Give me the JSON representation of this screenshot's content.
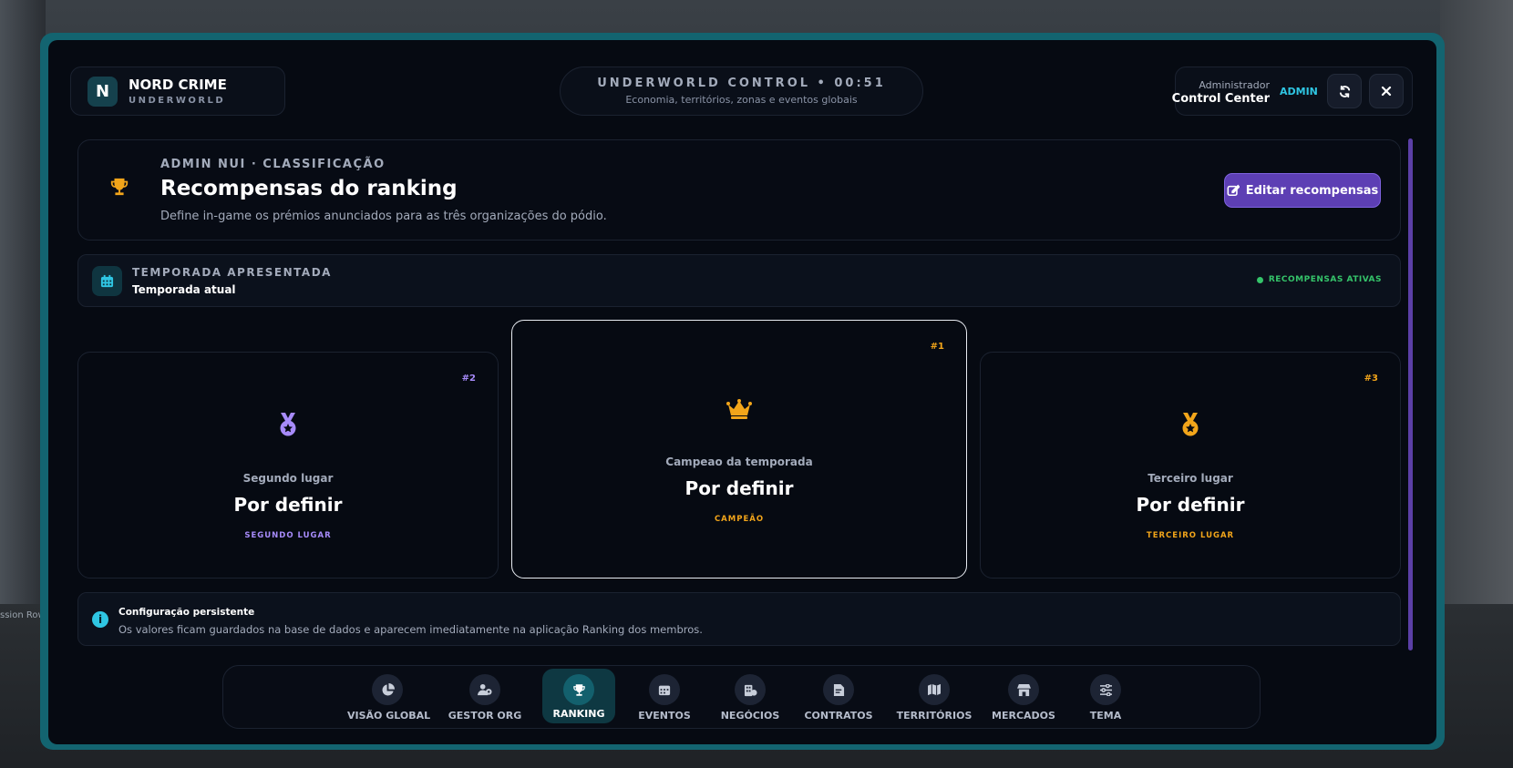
{
  "background": {
    "left_text": "ssion Row"
  },
  "brand": {
    "initial": "N",
    "title": "NORD CRIME",
    "subtitle": "UNDERWORLD"
  },
  "header": {
    "title": "UNDERWORLD CONTROL • 00:51",
    "subtitle": "Economia, territórios, zonas e eventos globais"
  },
  "admin": {
    "role": "Administrador",
    "name": "Control Center",
    "tag": "ADMIN"
  },
  "hero": {
    "kicker": "ADMIN NUI · CLASSIFICAÇÃO",
    "title": "Recompensas do ranking",
    "description": "Define in-game os prémios anunciados para as três organizações do pódio.",
    "edit_label": "Editar recompensas"
  },
  "season": {
    "kicker": "TEMPORADA APRESENTADA",
    "name": "Temporada atual",
    "status": "RECOMPENSAS ATIVAS"
  },
  "podium": {
    "second": {
      "rank": "#2",
      "subtitle": "Segundo lugar",
      "title": "Por definir",
      "tag": "SEGUNDO LUGAR",
      "color": "#a78bfa",
      "icon": "medal-icon"
    },
    "first": {
      "rank": "#1",
      "subtitle": "Campeao da temporada",
      "title": "Por definir",
      "tag": "CAMPEÃO",
      "color": "#f2a51a",
      "icon": "crown-icon"
    },
    "third": {
      "rank": "#3",
      "subtitle": "Terceiro lugar",
      "title": "Por definir",
      "tag": "TERCEIRO LUGAR",
      "color": "#f2a51a",
      "icon": "medal-icon"
    }
  },
  "info": {
    "title": "Configuração persistente",
    "description": "Os valores ficam guardados na base de dados e aparecem imediatamente na aplicação Ranking dos membros."
  },
  "nav": [
    {
      "label": "VISÃO GLOBAL",
      "icon": "pie-chart-icon"
    },
    {
      "label": "GESTOR ORG",
      "icon": "users-gear-icon"
    },
    {
      "label": "RANKING",
      "icon": "trophy-icon",
      "active": true
    },
    {
      "label": "EVENTOS",
      "icon": "calendar-icon"
    },
    {
      "label": "NEGÓCIOS",
      "icon": "business-icon"
    },
    {
      "label": "CONTRATOS",
      "icon": "file-contract-icon"
    },
    {
      "label": "TERRITÓRIOS",
      "icon": "map-icon"
    },
    {
      "label": "MERCADOS",
      "icon": "shop-icon"
    },
    {
      "label": "TEMA",
      "icon": "sliders-icon"
    }
  ],
  "colors": {
    "accent": "#2fc6e3",
    "primary_button": "#5d3fb4",
    "frame": "#136470",
    "active_status": "#35c46a"
  }
}
